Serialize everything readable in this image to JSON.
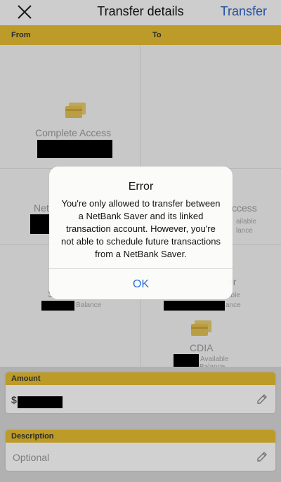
{
  "header": {
    "close_icon": "close-icon",
    "title": "Transfer details",
    "action_label": "Transfer"
  },
  "columns": {
    "from_label": "From",
    "to_label": "To"
  },
  "accounts": {
    "a1_name": "Complete Access",
    "a2_name": "Net",
    "a3_name": "ccess",
    "a3_sub1": "ailable",
    "a3_sub2": "lance",
    "a4_name": "S",
    "a4_sub": "Balance",
    "a5_name": "er",
    "a5_sub1": "able",
    "a5_sub2": "ance",
    "a6_name": "CDIA",
    "a6_sub1": "Available",
    "a6_sub2": "Balance"
  },
  "alert": {
    "title": "Error",
    "message": "You're only allowed to transfer between a NetBank Saver and its linked transaction account. However, you're not able to schedule future transactions from a NetBank Saver.",
    "ok_label": "OK"
  },
  "amount": {
    "label": "Amount",
    "currency": "$"
  },
  "description": {
    "label": "Description",
    "placeholder": "Optional"
  },
  "colors": {
    "accent": "#e6be33",
    "link": "#2b60c5"
  }
}
